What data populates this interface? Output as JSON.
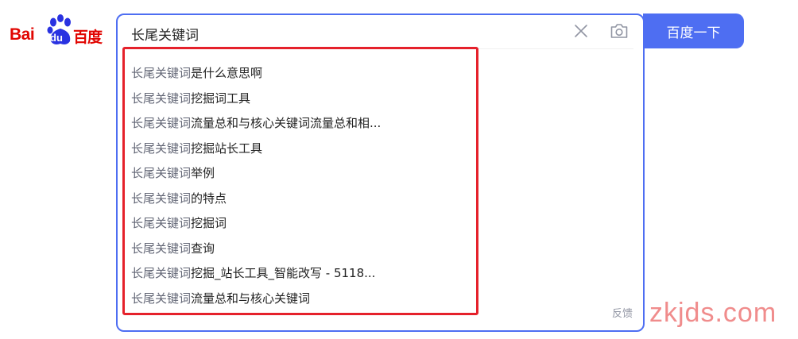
{
  "logo": {
    "text_left": "Bai",
    "text_paw": "du",
    "text_right": "百度"
  },
  "search": {
    "query": "长尾关键词",
    "clear_icon": "close-icon",
    "camera_icon": "camera-icon",
    "button_label": "百度一下"
  },
  "suggestions": [
    {
      "prefix": "长尾关键词",
      "suffix": "是什么意思啊"
    },
    {
      "prefix": "长尾关键词",
      "suffix": "挖掘词工具"
    },
    {
      "prefix": "长尾关键词",
      "suffix": "流量总和与核心关键词流量总和相..."
    },
    {
      "prefix": "长尾关键词",
      "suffix": "挖掘站长工具"
    },
    {
      "prefix": "长尾关键词",
      "suffix": "举例"
    },
    {
      "prefix": "长尾关键词",
      "suffix": "的特点"
    },
    {
      "prefix": "长尾关键词",
      "suffix": "挖掘词"
    },
    {
      "prefix": "长尾关键词",
      "suffix": "查询"
    },
    {
      "prefix": "长尾关键词",
      "suffix": "挖掘_站长工具_智能改写 - 5118..."
    },
    {
      "prefix": "长尾关键词",
      "suffix": "流量总和与核心关键词"
    }
  ],
  "feedback_label": "反馈",
  "watermark": "zkjds.com",
  "colors": {
    "brand_red": "#e10602",
    "brand_blue": "#2932e1",
    "accent": "#4e6ef2",
    "highlight_border": "#e5212b"
  }
}
